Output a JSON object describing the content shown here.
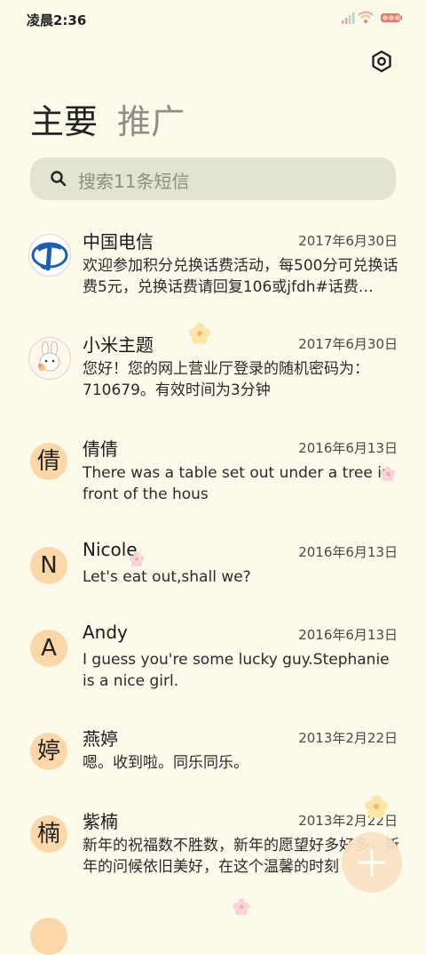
{
  "status_bar": {
    "time": "凌晨2:36"
  },
  "tabs": {
    "primary": "主要",
    "promotions": "推广"
  },
  "search": {
    "placeholder": "搜索11条短信"
  },
  "messages": [
    {
      "avatar": "",
      "name": "中国电信",
      "date": "2017年6月30日",
      "preview": "欢迎参加积分兑换话费活动，每500分可兑换话费5元，兑换话费请回复106或jfdh#话费…"
    },
    {
      "avatar": "",
      "name": "小米主题",
      "date": "2017年6月30日",
      "preview": "您好！您的网上营业厅登录的随机密码为：710679。有效时间为3分钟"
    },
    {
      "avatar": "倩",
      "name": "倩倩",
      "date": "2016年6月13日",
      "preview": "There was a table set out under a tree in front of the hous"
    },
    {
      "avatar": "N",
      "name": "Nicole",
      "date": "2016年6月13日",
      "preview": "Let's eat out,shall we?"
    },
    {
      "avatar": "A",
      "name": "Andy",
      "date": "2016年6月13日",
      "preview": "I guess you're some lucky guy.Stephanie is a nice girl."
    },
    {
      "avatar": "婷",
      "name": "燕婷",
      "date": "2013年2月22日",
      "preview": "嗯。收到啦。同乐同乐。"
    },
    {
      "avatar": "楠",
      "name": "紫楠",
      "date": "2013年2月22日",
      "preview": "新年的祝福数不胜数，新年的愿望好多好多，新年的问候依旧美好，在这个温馨的时刻"
    }
  ],
  "colors": {
    "background": "#fbfaeb",
    "search_bg": "#e2e4cf",
    "avatar_bg": "#fdd7a8",
    "fab_bg": "#fbe3c2"
  },
  "icons": {
    "settings": "settings-icon",
    "search": "search-icon",
    "compose": "plus-icon"
  }
}
